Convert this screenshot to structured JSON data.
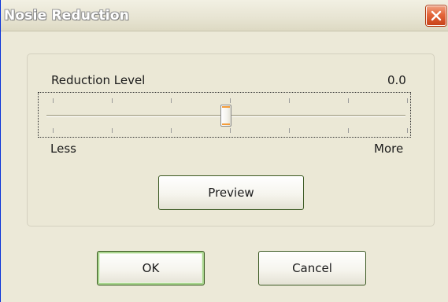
{
  "window": {
    "title": "Nosie Reduction"
  },
  "icons": {
    "close": "close-icon"
  },
  "colors": {
    "titlebar_text": "#ffffff",
    "close_button": "#e3653a",
    "window_bg": "#ece9d8",
    "thumb_accent": "#f39c3a",
    "default_button_highlight": "#a7d48c"
  },
  "reduction": {
    "label": "Reduction Level",
    "value_text": "0.0",
    "min_label": "Less",
    "max_label": "More",
    "position": 0.5
  },
  "buttons": {
    "preview": "Preview",
    "ok": "OK",
    "cancel": "Cancel"
  }
}
